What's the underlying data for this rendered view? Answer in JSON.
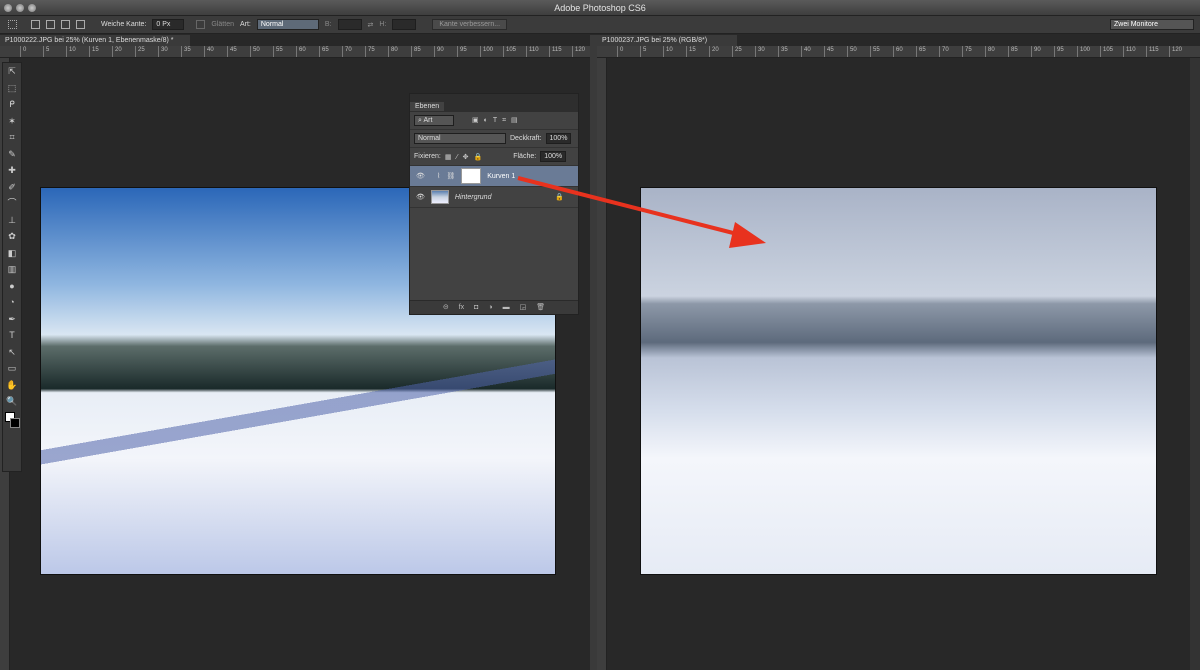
{
  "app": {
    "title": "Adobe Photoshop CS6"
  },
  "options": {
    "feather_label": "Weiche Kante:",
    "feather_value": "0 Px",
    "antialias_label": "Glätten",
    "style_label": "Art:",
    "style_value": "Normal",
    "width_label": "B:",
    "height_label": "H:",
    "refine_button": "Kante verbessern...",
    "workspace": "Zwei Monitore"
  },
  "docs": [
    {
      "tab": "P1000222.JPG bei 25% (Kurven 1, Ebenenmaske/8) *",
      "ruler": [
        "0",
        "5",
        "10",
        "15",
        "20",
        "25",
        "30",
        "35",
        "40",
        "45",
        "50",
        "55",
        "60",
        "65",
        "70",
        "75",
        "80",
        "85",
        "90",
        "95",
        "100",
        "105",
        "110",
        "115",
        "120"
      ]
    },
    {
      "tab": "P1000237.JPG bei 25% (RGB/8*)",
      "ruler": [
        "0",
        "5",
        "10",
        "15",
        "20",
        "25",
        "30",
        "35",
        "40",
        "45",
        "50",
        "55",
        "60",
        "65",
        "70",
        "75",
        "80",
        "85",
        "90",
        "95",
        "100",
        "105",
        "110",
        "115",
        "120"
      ]
    }
  ],
  "tools": [
    "⇱",
    "⬚",
    "ᑭ",
    "✶",
    "⌗",
    "✎",
    "✚",
    "✐",
    "⌒",
    "⊥",
    "✿",
    "◧",
    "▥",
    "●",
    "◔",
    "✒",
    "T",
    "↖",
    "▭",
    "✋",
    "🔍"
  ],
  "layers": {
    "title": "Ebenen",
    "filter": "Art",
    "blend": "Normal",
    "opacity_label": "Deckkraft:",
    "opacity": "100%",
    "lock_label": "Fixieren:",
    "fill_label": "Fläche:",
    "fill": "100%",
    "items": [
      {
        "name": "Kurven 1",
        "selected": true
      },
      {
        "name": "Hintergrund",
        "locked": true
      }
    ],
    "footer": [
      "⊝",
      "fx",
      "◘",
      "◑",
      "▬",
      "◲",
      "🗑"
    ]
  },
  "colors": {
    "arrow": "#e8321e",
    "selected": "#6a7b96"
  }
}
